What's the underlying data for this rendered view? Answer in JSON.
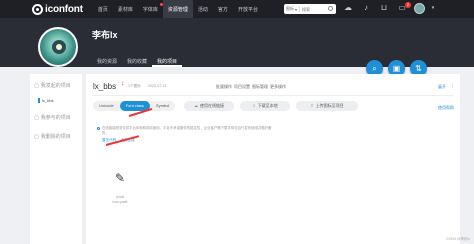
{
  "topbar": {
    "logo_text": "iconfont",
    "nav": [
      {
        "label": "首页",
        "active": false
      },
      {
        "label": "素材库",
        "active": false
      },
      {
        "label": "字体库",
        "active": false
      },
      {
        "label": "资源管理",
        "active": true
      },
      {
        "label": "活动",
        "active": false
      },
      {
        "label": "官方",
        "active": false
      },
      {
        "label": "开放平台",
        "active": false
      }
    ],
    "search": {
      "scope": "图标",
      "placeholder": "搜索"
    },
    "notification_count": "2"
  },
  "profile": {
    "username": "李布lx",
    "tabs": [
      {
        "label": "我的资源",
        "active": false
      },
      {
        "label": "我的收藏",
        "active": false
      },
      {
        "label": "我的项目",
        "active": true
      }
    ]
  },
  "sidebar": {
    "items": [
      {
        "label": "我发起的项目",
        "icon": "folder-icon"
      },
      {
        "label": "我参与的项目",
        "icon": "folder-icon"
      },
      {
        "label": "我删除的项目",
        "icon": "trash-icon"
      }
    ],
    "active_project": "lx_bbs"
  },
  "project": {
    "name": "lx_bbs",
    "icon_count": "1个图标",
    "date": "2023-07-13",
    "actions_right": [
      "批量操作",
      "项目设置",
      "图标管理",
      "更多操作"
    ],
    "segments": [
      {
        "label": "Unicode",
        "active": false
      },
      {
        "label": "Font class",
        "active": true
      },
      {
        "label": "Symbol",
        "active": false
      }
    ],
    "tools": [
      {
        "label": "使用在线链接",
        "icon": "cloud-icon"
      },
      {
        "label": "下载至本地",
        "icon": "download-icon"
      },
      {
        "label": "上传图标至项目",
        "icon": "upload-icon"
      }
    ],
    "side_links": [
      "展开",
      "使用帮助"
    ],
    "notice": "在线链接服务仅供平台体验和调试使用，平台不承诺服务的稳定性，企业客户需下载字体包自行发布使用并做好备份。",
    "notice_links": [
      "暂无代码",
      "点此生成"
    ],
    "icons": [
      {
        "name": "pnaft",
        "code": "icon-pnaft",
        "glyph": "✎"
      }
    ]
  },
  "watermark": "CSDN @李布lx",
  "colors": {
    "accent": "#1f8fd6",
    "topbar": "#1f2025",
    "banner": "#2a2d36",
    "arrow": "#e33333"
  }
}
